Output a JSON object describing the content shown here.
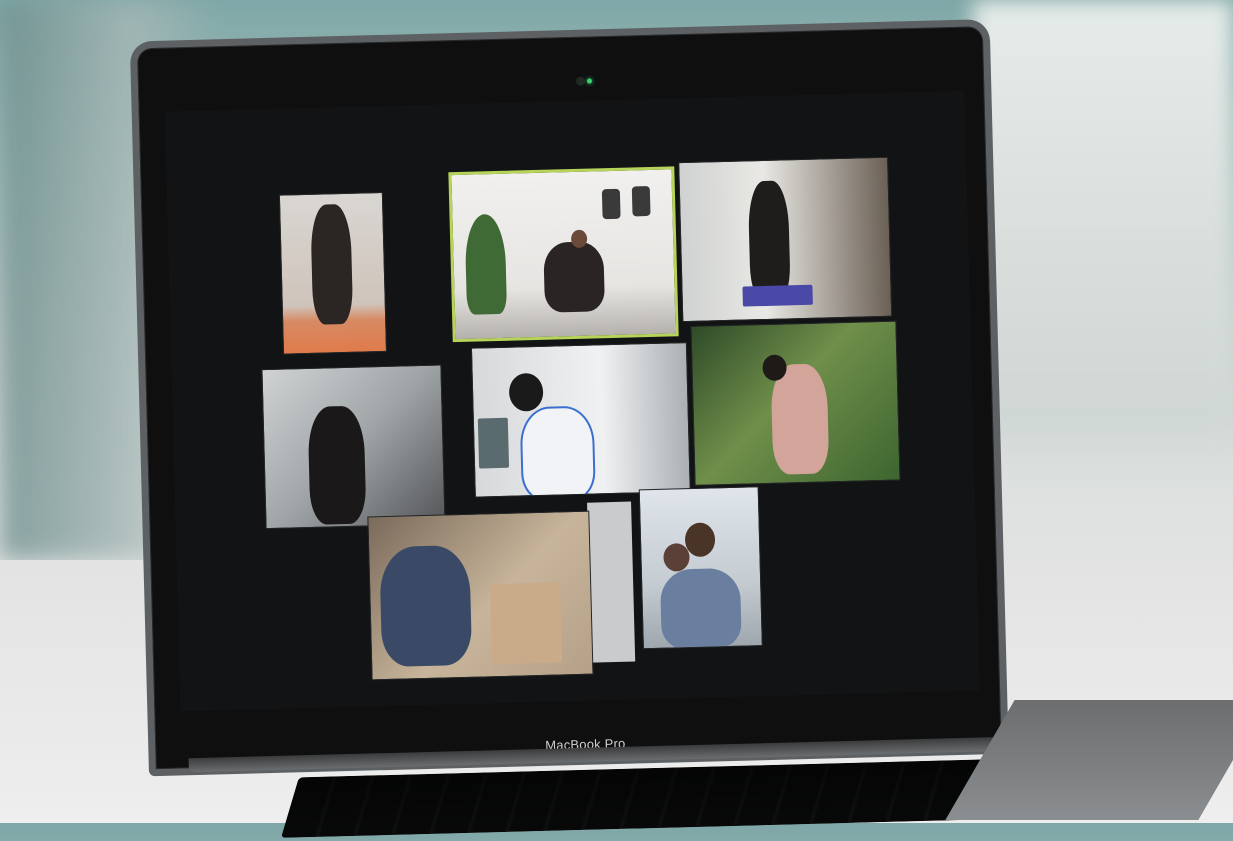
{
  "laptop": {
    "brand_label": "MacBook Pro"
  },
  "video_call": {
    "participant_tiles": 8,
    "active_speaker_highlight_color": "#b6d35a"
  }
}
